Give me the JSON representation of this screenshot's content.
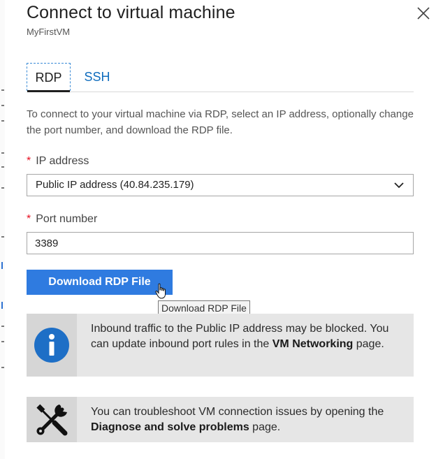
{
  "panel": {
    "title": "Connect to virtual machine",
    "subtitle": "MyFirstVM"
  },
  "tabs": [
    {
      "label": "RDP",
      "active": true
    },
    {
      "label": "SSH",
      "active": false
    }
  ],
  "description": "To connect to your virtual machine via RDP, select an IP address, optionally change the port number, and download the RDP file.",
  "ip_field": {
    "required_marker": "*",
    "label": "IP address",
    "selected_value": "Public IP address (40.84.235.179)"
  },
  "port_field": {
    "required_marker": "*",
    "label": "Port number",
    "value": "3389"
  },
  "download_button": {
    "label": "Download RDP File",
    "tooltip": "Download RDP File"
  },
  "notices": [
    {
      "icon": "info-icon",
      "text_before": "Inbound traffic to the Public IP address may be blocked. You can update inbound port rules in the ",
      "link_text": "VM Networking",
      "text_after": " page."
    },
    {
      "icon": "tools-icon",
      "text_before": "You can troubleshoot VM connection issues by opening the ",
      "link_text": "Diagnose and solve problems",
      "text_after": " page."
    }
  ],
  "colors": {
    "accent": "#2f7be0",
    "link": "#0f6cbd",
    "required": "#e81123",
    "info_circle": "#1e6fc6"
  }
}
